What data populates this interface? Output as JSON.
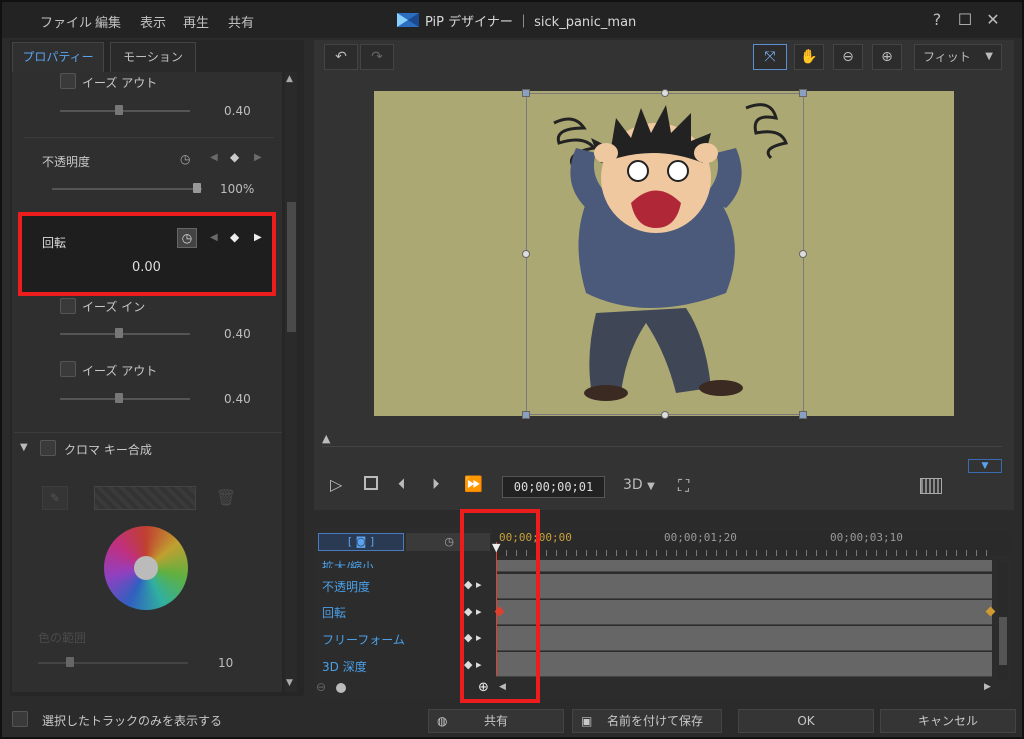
{
  "menu": [
    "ファイル",
    "編集",
    "表示",
    "再生",
    "共有"
  ],
  "window": {
    "title": "PiP デザイナー ｜ sick_panic_man"
  },
  "tabs": [
    {
      "label": "プロパティー"
    },
    {
      "label": "モーション"
    }
  ],
  "props": {
    "ease_out_1": {
      "label": "イーズ アウト",
      "value": "0.40"
    },
    "opacity": {
      "label": "不透明度",
      "value": "100%"
    },
    "rotation": {
      "label": "回転",
      "value": "0.00"
    },
    "ease_in": {
      "label": "イーズ イン",
      "value": "0.40"
    },
    "ease_out_2": {
      "label": "イーズ アウト",
      "value": "0.40"
    },
    "chroma": {
      "label": "クロマ キー合成"
    },
    "color_range": {
      "label": "色の範囲",
      "value": "10"
    }
  },
  "preview": {
    "zoom": "フィット",
    "timecode": "00;00;00;01",
    "mode_3d": "3D"
  },
  "timeline": {
    "ruler": [
      "00;00;00;00",
      "00;00;01;20",
      "00;00;03;10"
    ],
    "tracks": [
      {
        "label": "拡大/縮小"
      },
      {
        "label": "不透明度"
      },
      {
        "label": "回転"
      },
      {
        "label": "フリーフォーム"
      },
      {
        "label": "3D 深度"
      }
    ]
  },
  "bottom": {
    "only_selected_label": "選択したトラックのみを表示する",
    "share": "共有",
    "save_as": "名前を付けて保存",
    "ok": "OK",
    "cancel": "キャンセル"
  },
  "colors": {
    "accent": "#4aa0e8",
    "highlight": "#ee1d1d",
    "canvas_bg": "#aca874"
  }
}
